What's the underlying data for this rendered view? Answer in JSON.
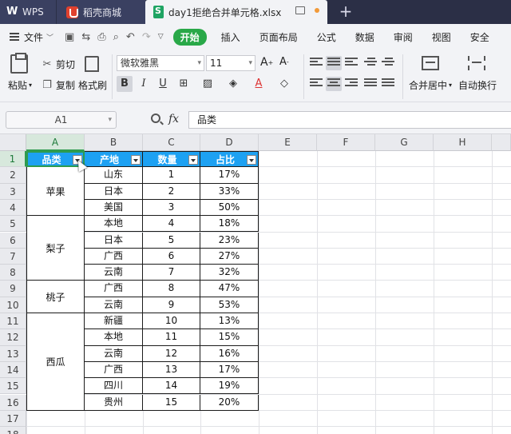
{
  "tabs": [
    {
      "label": "WPS",
      "icon": "wps-logo-icon"
    },
    {
      "label": "稻壳商城",
      "icon": "docer-mall-icon"
    },
    {
      "label": "day1拒绝合并单元格.xlsx",
      "icon": "spreadsheet-file-icon",
      "active": true
    }
  ],
  "menubar": {
    "file_label": "文件",
    "start_label": "开始",
    "items": [
      "插入",
      "页面布局",
      "公式",
      "数据",
      "审阅",
      "视图",
      "安全"
    ]
  },
  "ribbon": {
    "paste_label": "粘贴",
    "cut_label": "剪切",
    "copy_label": "复制",
    "format_painter_label": "格式刷",
    "font_name": "微软雅黑",
    "font_size": "11",
    "merge_label": "合并居中",
    "wrap_label": "自动换行"
  },
  "formula_bar": {
    "cell_ref": "A1",
    "fx_label": "fx",
    "content": "品类"
  },
  "sheet": {
    "columns": [
      "A",
      "B",
      "C",
      "D",
      "E",
      "F",
      "G",
      "H"
    ],
    "rows": [
      "1",
      "2",
      "3",
      "4",
      "5",
      "6",
      "7",
      "8",
      "9",
      "10",
      "11",
      "12",
      "13",
      "14",
      "15",
      "16",
      "17",
      "18"
    ],
    "headers": [
      "品类",
      "产地",
      "数量",
      "占比"
    ],
    "groups": [
      {
        "name": "苹果",
        "start": 2,
        "end": 4
      },
      {
        "name": "梨子",
        "start": 5,
        "end": 8
      },
      {
        "name": "桃子",
        "start": 9,
        "end": 10
      },
      {
        "name": "西瓜",
        "start": 11,
        "end": 16
      }
    ],
    "data": [
      [
        "山东",
        "1",
        "17%"
      ],
      [
        "日本",
        "2",
        "33%"
      ],
      [
        "美国",
        "3",
        "50%"
      ],
      [
        "本地",
        "4",
        "18%"
      ],
      [
        "日本",
        "5",
        "23%"
      ],
      [
        "广西",
        "6",
        "27%"
      ],
      [
        "云南",
        "7",
        "32%"
      ],
      [
        "广西",
        "8",
        "47%"
      ],
      [
        "云南",
        "9",
        "53%"
      ],
      [
        "新疆",
        "10",
        "13%"
      ],
      [
        "本地",
        "11",
        "15%"
      ],
      [
        "云南",
        "12",
        "16%"
      ],
      [
        "广西",
        "13",
        "17%"
      ],
      [
        "四川",
        "14",
        "19%"
      ],
      [
        "贵州",
        "15",
        "20%"
      ]
    ],
    "colors": {
      "header_bg": "#1da1f2",
      "selection": "#2e9b4f"
    }
  }
}
